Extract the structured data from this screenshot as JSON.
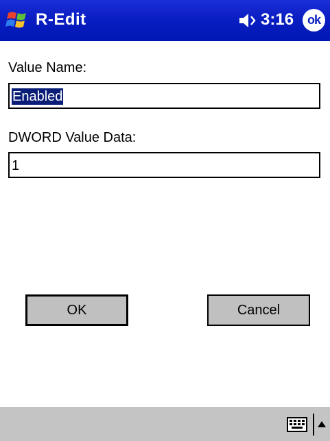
{
  "titlebar": {
    "app_title": "R-Edit",
    "clock": "3:16",
    "ok_label": "ok",
    "start_icon": "windows-flag-icon",
    "volume_icon": "speaker-icon"
  },
  "form": {
    "value_name_label": "Value Name:",
    "value_name": "Enabled",
    "dword_label": "DWORD Value Data:",
    "dword_value": "1"
  },
  "buttons": {
    "ok": "OK",
    "cancel": "Cancel"
  },
  "bottombar": {
    "keyboard_icon": "keyboard-icon",
    "sip_arrow_icon": "up-arrow-icon"
  },
  "colors": {
    "titlebar": "#0a1ec2",
    "selection": "#0a1e78",
    "button_face": "#c0c0c0",
    "menubar": "#c4c4c4"
  }
}
